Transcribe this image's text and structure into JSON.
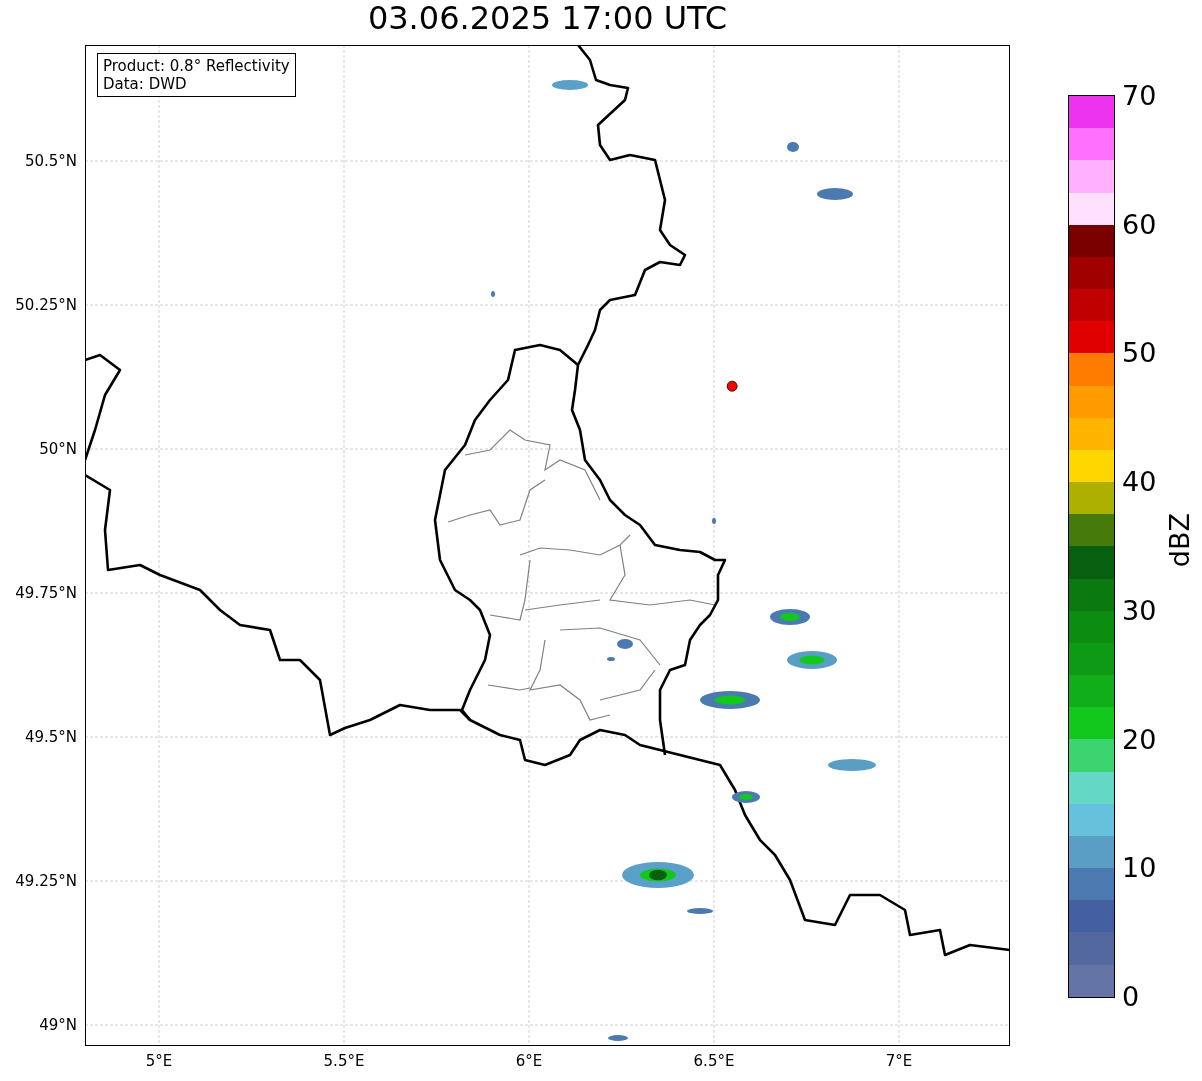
{
  "title": "03.06.2025 17:00 UTC",
  "legend": {
    "lines": [
      "Product: 0.8° Reflectivity",
      "Data: DWD"
    ]
  },
  "map": {
    "xticks": [
      "5°E",
      "5.5°E",
      "6°E",
      "6.5°E",
      "7°E"
    ],
    "yticks": [
      "50.5°N",
      "50.25°N",
      "50°N",
      "49.75°N",
      "49.5°N",
      "49.25°N",
      "49°N"
    ]
  },
  "colorbar": {
    "label": "dBZ",
    "ticks": [
      "70",
      "60",
      "50",
      "40",
      "30",
      "20",
      "10",
      "0"
    ],
    "segments": [
      {
        "color": "#ee33ee"
      },
      {
        "color": "#ff70ff"
      },
      {
        "color": "#ffb0ff"
      },
      {
        "color": "#ffe0ff"
      },
      {
        "color": "#7a0000"
      },
      {
        "color": "#a00000"
      },
      {
        "color": "#c00000"
      },
      {
        "color": "#e00000"
      },
      {
        "color": "#ff7c00"
      },
      {
        "color": "#ff9a00"
      },
      {
        "color": "#ffb400"
      },
      {
        "color": "#ffd700"
      },
      {
        "color": "#aeb000"
      },
      {
        "color": "#467a0a"
      },
      {
        "color": "#066010"
      },
      {
        "color": "#0a7a10"
      },
      {
        "color": "#0c8c10"
      },
      {
        "color": "#0e9a14"
      },
      {
        "color": "#10ae18"
      },
      {
        "color": "#12c81c"
      },
      {
        "color": "#3cd470"
      },
      {
        "color": "#64d8c4"
      },
      {
        "color": "#66c2dc"
      },
      {
        "color": "#5a9ec6"
      },
      {
        "color": "#4a7ab0"
      },
      {
        "color": "#4460a0"
      },
      {
        "color": "#5468a0"
      },
      {
        "color": "#6474a4"
      }
    ]
  }
}
